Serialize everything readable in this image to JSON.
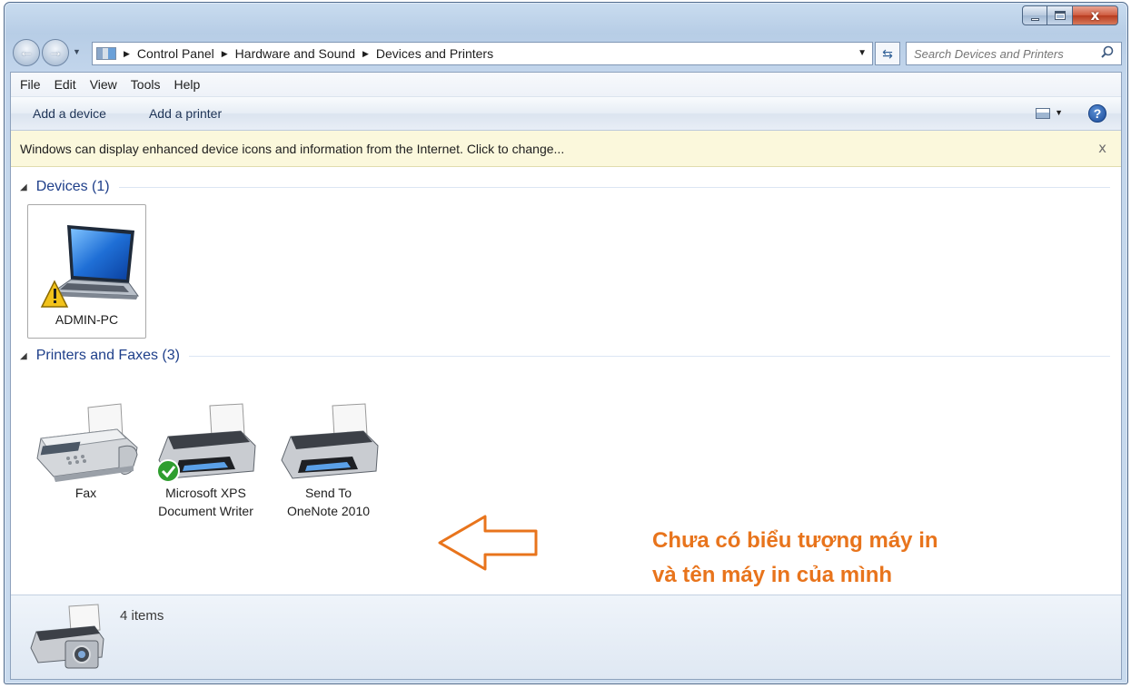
{
  "window": {
    "caption_buttons": {
      "minimize": "",
      "maximize": "",
      "close": "x"
    }
  },
  "navigation": {
    "breadcrumbs": [
      "Control Panel",
      "Hardware and Sound",
      "Devices and Printers"
    ],
    "search_placeholder": "Search Devices and Printers"
  },
  "menu": [
    "File",
    "Edit",
    "View",
    "Tools",
    "Help"
  ],
  "commands": {
    "add_device": "Add a device",
    "add_printer": "Add a printer",
    "help": "?"
  },
  "infobar": {
    "message": "Windows can display enhanced device icons and information from the Internet. Click to change...",
    "close": "x"
  },
  "groups": {
    "devices": {
      "title": "Devices (1)",
      "items": [
        {
          "name": "ADMIN-PC",
          "icon": "laptop-warning-icon"
        }
      ]
    },
    "printers": {
      "title": "Printers and Faxes (3)",
      "items": [
        {
          "name": "Fax",
          "icon": "fax-icon"
        },
        {
          "name_line1": "Microsoft XPS",
          "name_line2": "Document Writer",
          "icon": "printer-default-icon"
        },
        {
          "name_line1": "Send To",
          "name_line2": "OneNote 2010",
          "icon": "printer-icon"
        }
      ]
    }
  },
  "annotation": {
    "line1": "Chưa có biểu tượng máy in",
    "line2": "và tên máy in của mình",
    "color": "#e8741c"
  },
  "details_pane": {
    "count": "4 items"
  }
}
